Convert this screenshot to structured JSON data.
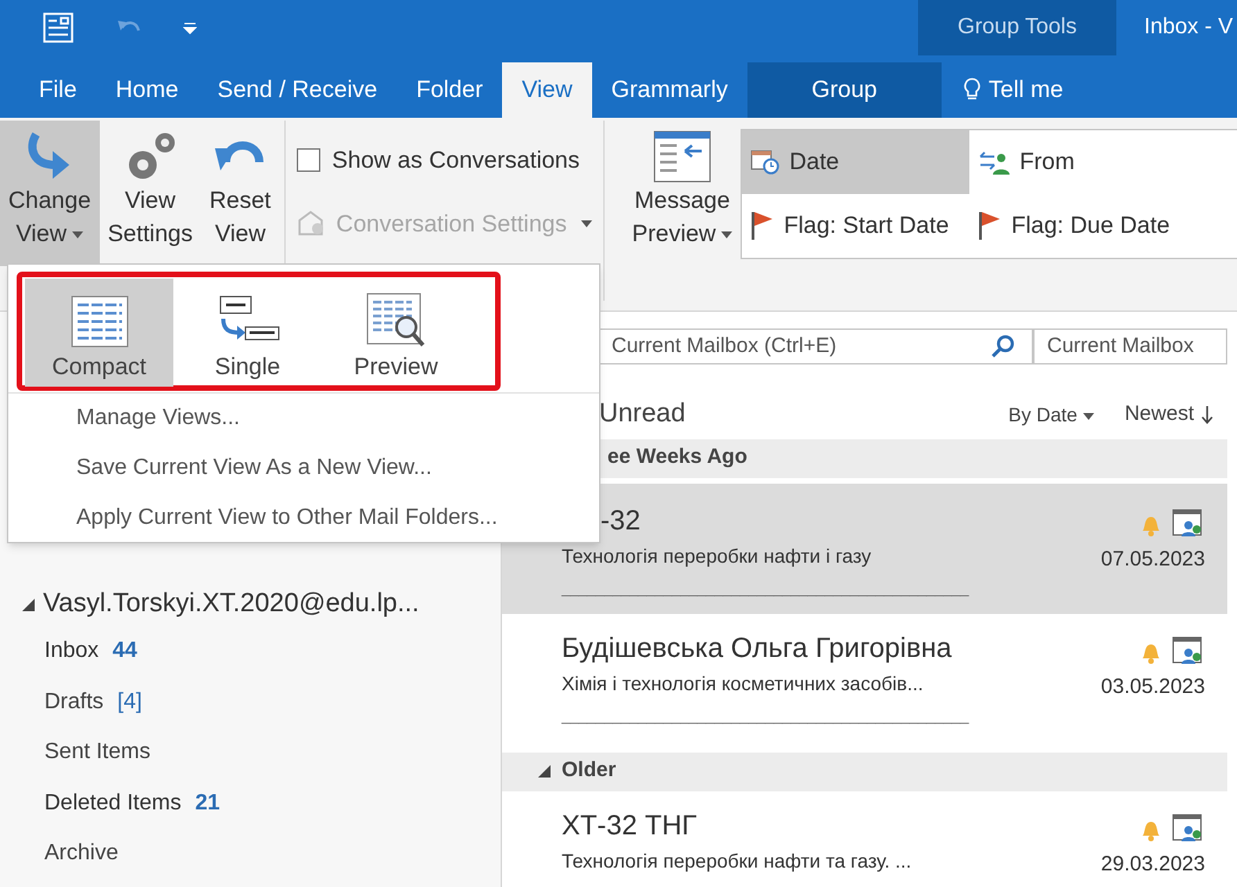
{
  "title_bar": {
    "context_group": "Group Tools",
    "title": "Inbox - V"
  },
  "tabs": [
    {
      "label": "File",
      "selected": false,
      "kind": "normal"
    },
    {
      "label": "Home",
      "selected": false,
      "kind": "normal"
    },
    {
      "label": "Send / Receive",
      "selected": false,
      "kind": "normal"
    },
    {
      "label": "Folder",
      "selected": false,
      "kind": "normal"
    },
    {
      "label": "View",
      "selected": true,
      "kind": "normal"
    },
    {
      "label": "Grammarly",
      "selected": false,
      "kind": "normal"
    },
    {
      "label": "Group",
      "selected": false,
      "kind": "contextual"
    }
  ],
  "tell_me": "Tell me",
  "ribbon": {
    "view_buttons": [
      {
        "kind": "change_view",
        "lines": [
          "Change",
          "View"
        ],
        "has_menu": true,
        "pressed": true
      },
      {
        "kind": "view_settings",
        "lines": [
          "View",
          "Settings"
        ],
        "has_menu": false,
        "pressed": false
      },
      {
        "kind": "reset_view",
        "lines": [
          "Reset",
          "View"
        ],
        "has_menu": false,
        "pressed": false
      }
    ],
    "show_as_conversations": {
      "label": "Show as Conversations",
      "checked": false
    },
    "conversation_settings": {
      "label": "Conversation Settings",
      "disabled": true
    },
    "message_preview": {
      "lines": [
        "Message",
        "Preview"
      ]
    },
    "arrangement": [
      {
        "kind": "date",
        "label": "Date",
        "selected": true
      },
      {
        "kind": "from",
        "label": "From",
        "selected": false
      },
      {
        "kind": "flag",
        "label": "Flag: Start Date",
        "selected": false
      },
      {
        "kind": "flag",
        "label": "Flag: Due Date",
        "selected": false
      }
    ]
  },
  "view_menu": {
    "views": [
      {
        "kind": "compact",
        "label": "Compact",
        "selected": true
      },
      {
        "kind": "single",
        "label": "Single",
        "selected": false
      },
      {
        "kind": "preview",
        "label": "Preview",
        "selected": false
      }
    ],
    "items": [
      "Manage Views...",
      "Save Current View As a New View...",
      "Apply Current View to Other Mail Folders..."
    ]
  },
  "folders": {
    "account": "Vasyl.Torskyi.XT.2020@edu.lp...",
    "expanded": true,
    "children": [
      {
        "name": "Inbox",
        "count": "44",
        "kind": "unread"
      },
      {
        "name": "Drafts",
        "count": "[4]",
        "kind": "drafts"
      },
      {
        "name": "Sent Items",
        "kind": "plain"
      },
      {
        "name": "Deleted Items",
        "count": "21",
        "kind": "unread"
      },
      {
        "name": "Archive",
        "kind": "plain"
      }
    ]
  },
  "search": {
    "placeholder": "Current Mailbox (Ctrl+E)",
    "scope": "Current Mailbox"
  },
  "filter": {
    "unread": "Unread",
    "sort": "By Date",
    "order": "Newest"
  },
  "groups": [
    {
      "header": "ee Weeks Ago",
      "messages": [
        {
          "sender": "-32",
          "subject": "Технологія переробки нафти і газу",
          "preview": "________________________________________________",
          "date": "07.05.2023",
          "selected": true
        },
        {
          "sender": "Будішевська Ольга Григорівна",
          "subject": "Хімія і технологія косметичних засобів...",
          "preview": "________________________________________________",
          "date": "03.05.2023",
          "selected": false
        }
      ]
    },
    {
      "header": "Older",
      "expanded": true,
      "messages": [
        {
          "sender": "ХТ-32 ТНГ",
          "subject": "Технологія переробки нафти та газу. ...",
          "date": "29.03.2023",
          "selected": false
        }
      ]
    }
  ]
}
